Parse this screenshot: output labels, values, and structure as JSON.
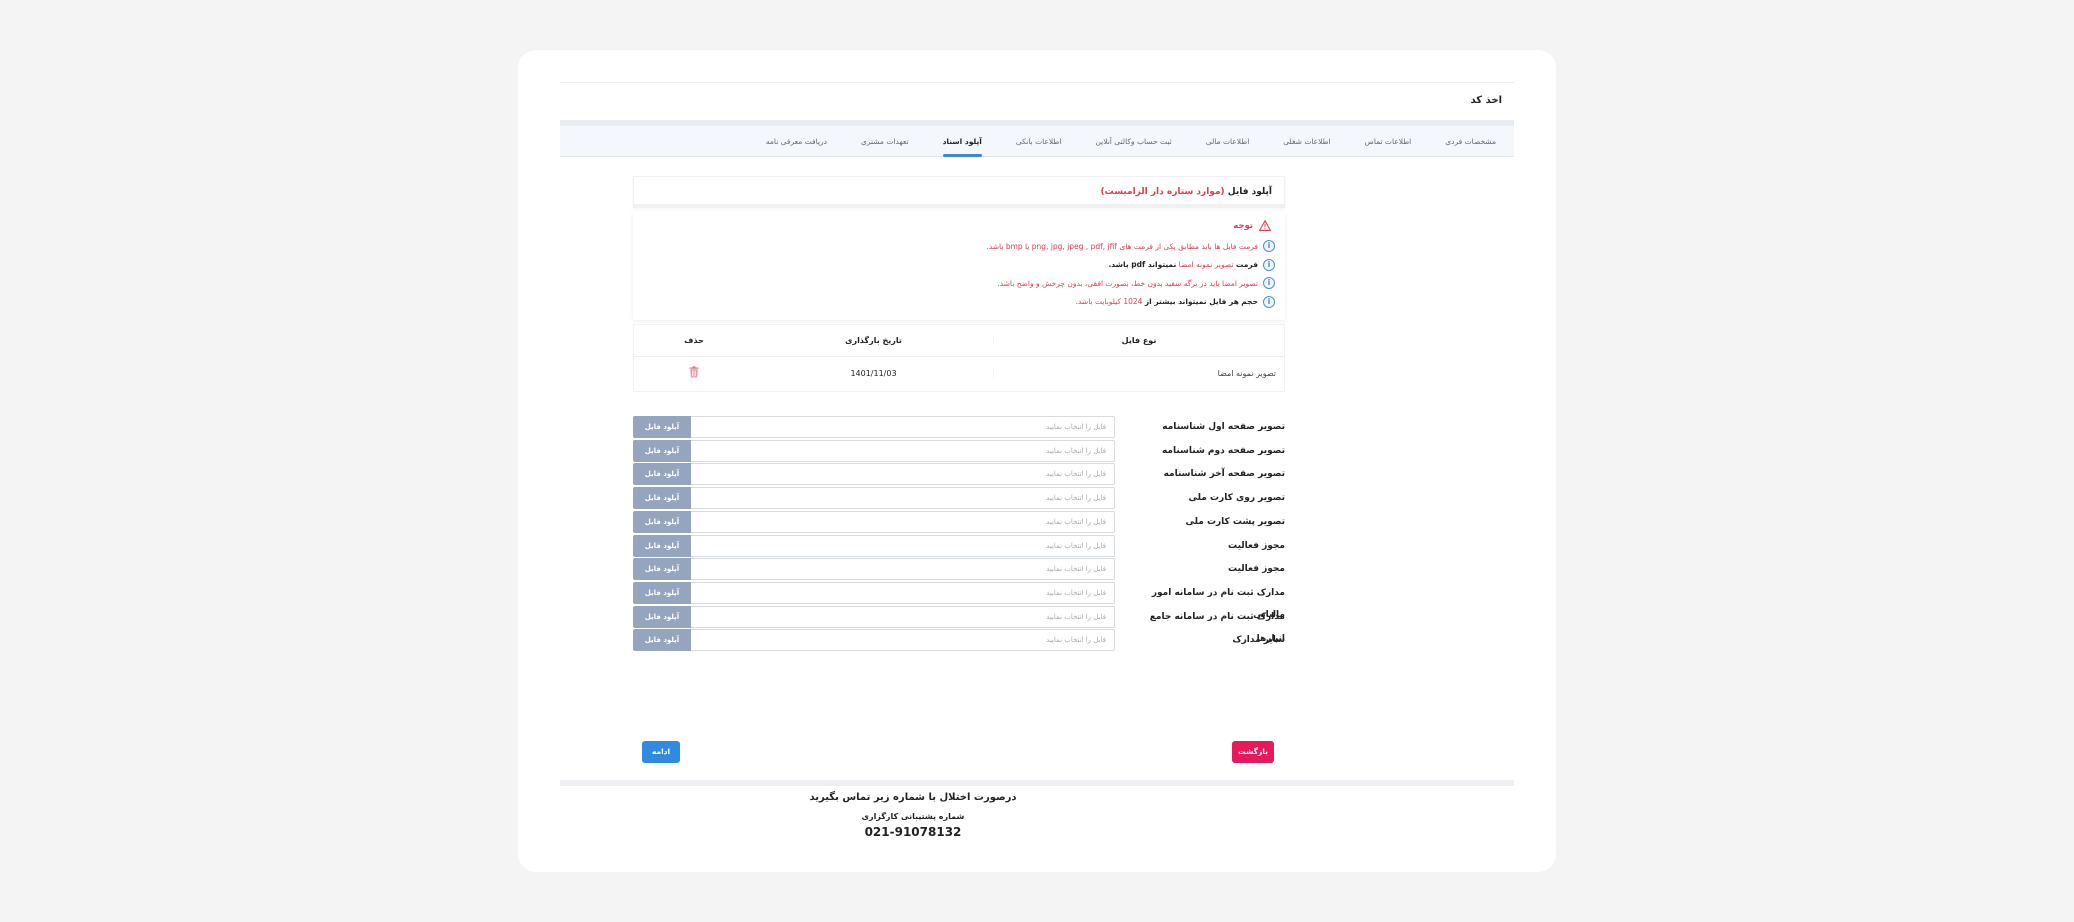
{
  "page": {
    "title": "اخذ کد"
  },
  "tabs": [
    {
      "label": "مشخصات فردی",
      "active": false
    },
    {
      "label": "اطلاعات تماس",
      "active": false
    },
    {
      "label": "اطلاعات شغلی",
      "active": false
    },
    {
      "label": "اطلاعات مالی",
      "active": false
    },
    {
      "label": "ثبت حساب وکالتی آنلاین",
      "active": false
    },
    {
      "label": "اطلاعات بانکی",
      "active": false
    },
    {
      "label": "آپلود اسناد",
      "active": true
    },
    {
      "label": "تعهدات مشتری",
      "active": false
    },
    {
      "label": "دریافت معرفی نامه",
      "active": false
    }
  ],
  "upload_section": {
    "title": "آپلود فایل",
    "required_note": "(موارد ستاره دار الزامیست)"
  },
  "notice": {
    "title": "توجه",
    "lines": [
      {
        "prefix": "",
        "highlight": "فرمت فایل ها باید مطابق یکی از فرمت های png, jpg, jpeg , pdf, jfif یا bmp باشد.",
        "suffix": "",
        "style": "red"
      },
      {
        "prefix": "فرمت",
        "highlight": "تصویر نمونه امضا",
        "suffix": "نمیتواند pdf باشد.",
        "style": "mixed"
      },
      {
        "prefix": "",
        "highlight": "تصویر امضا باید در برگه سفید بدون خط، بصورت افقی، بدون چرخش و واضح باشد.",
        "suffix": "",
        "style": "red"
      },
      {
        "prefix": "حجم",
        "highlight": "هر فایل نمیتواند بیشتر از",
        "suffix": "1024 کیلوبایت باشد.",
        "style": "mixed2"
      }
    ]
  },
  "files_table": {
    "headers": {
      "type": "نوع فایل",
      "date": "تاریخ بارگذاری",
      "delete": "حذف"
    },
    "rows": [
      {
        "type": "تصویر نمونه امضا",
        "date": "1401/11/03"
      }
    ]
  },
  "upload_fields": {
    "placeholder": "فایل را انتخاب نمایید",
    "button_label": "آپلود فایل",
    "items": [
      "تصویر صفحه اول شناسنامه",
      "تصویر صفحه دوم شناسنامه",
      "تصویر صفحه آخر شناسنامه",
      "تصویر روی کارت ملی",
      "تصویر پشت کارت ملی",
      "مجوز فعالیت",
      "مجوز فعالیت",
      "مدارک ثبت نام در سامانه امور مالیاتی",
      "مدارک ثبت نام در سامانه جامع انبارها",
      "سایر مدارک"
    ]
  },
  "actions": {
    "back": "بازگشت",
    "next": "ادامه"
  },
  "footer": {
    "contact_text": "درصورت اختلال با شماره زیر تماس بگیرید",
    "support_label": "شماره پشتیبانی کارگزاری",
    "phone": "021-91078132"
  },
  "colors": {
    "accent_blue": "#2f8ae0",
    "danger": "#e8185b",
    "upload_btn": "#95a5bf"
  }
}
